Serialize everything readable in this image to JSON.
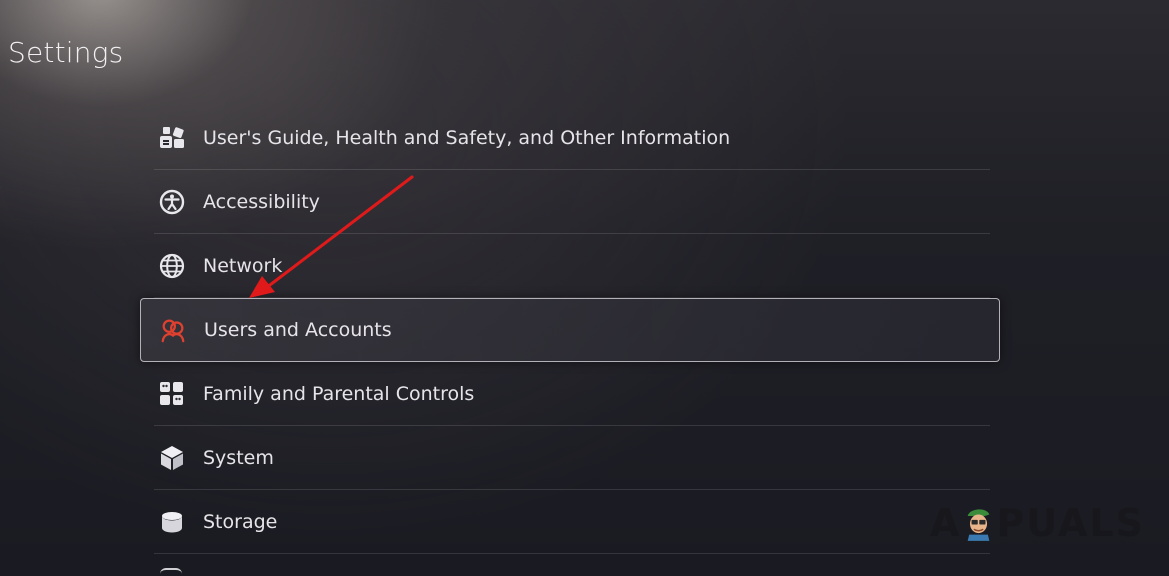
{
  "page": {
    "title": "Settings"
  },
  "menu": {
    "items": [
      {
        "label": "User's Guide, Health and Safety, and Other Information",
        "icon": "guide-info-icon"
      },
      {
        "label": "Accessibility",
        "icon": "accessibility-icon"
      },
      {
        "label": "Network",
        "icon": "globe-icon"
      },
      {
        "label": "Users and Accounts",
        "icon": "users-accounts-icon",
        "selected": true
      },
      {
        "label": "Family and Parental Controls",
        "icon": "family-controls-icon"
      },
      {
        "label": "System",
        "icon": "cube-icon"
      },
      {
        "label": "Storage",
        "icon": "storage-cylinder-icon"
      }
    ]
  },
  "watermark": {
    "left": "A",
    "right": "PUALS"
  },
  "colors": {
    "accent_red": "#e0402f",
    "arrow_red": "#e01a1a",
    "text": "#e6e4e8"
  }
}
